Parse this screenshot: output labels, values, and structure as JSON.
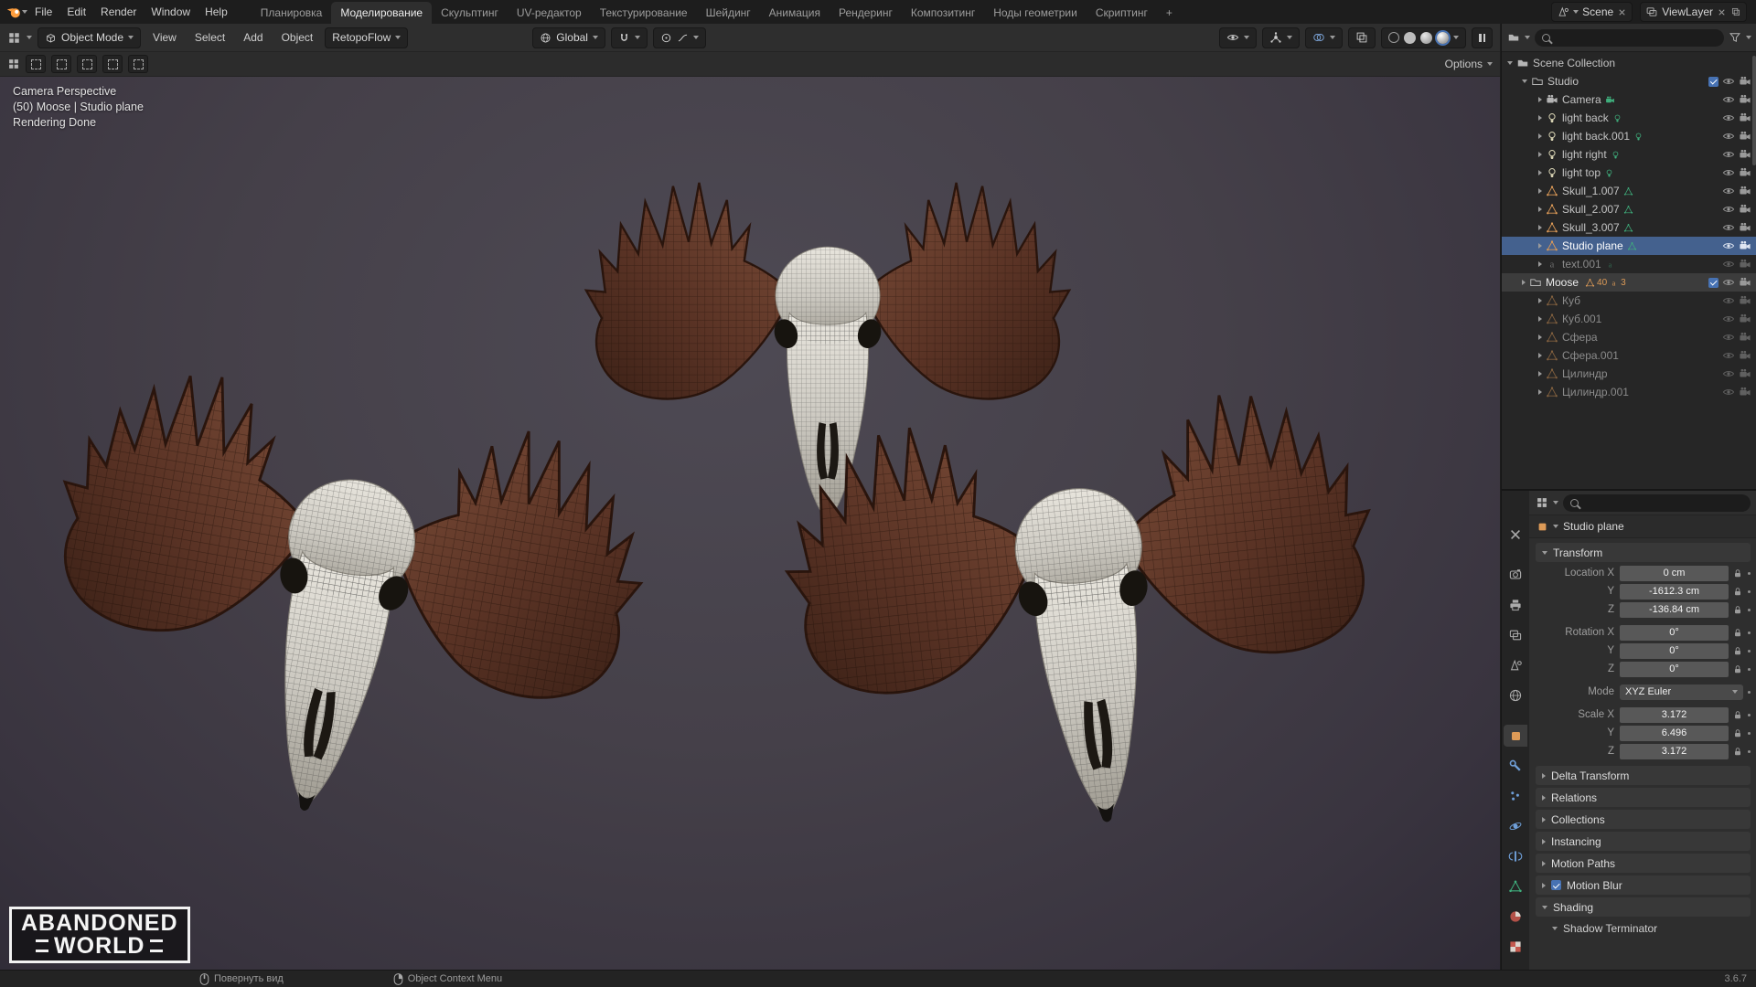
{
  "topbar": {
    "menus": [
      "File",
      "Edit",
      "Render",
      "Window",
      "Help"
    ],
    "workspaces": [
      "Планировка",
      "Моделирование",
      "Скульптинг",
      "UV-редактор",
      "Текстурирование",
      "Шейдинг",
      "Анимация",
      "Рендеринг",
      "Композитинг",
      "Ноды геометрии",
      "Скриптинг"
    ],
    "active_workspace": "Моделирование",
    "add_workspace_label": "+",
    "scene": {
      "label": "Scene"
    },
    "view_layer": {
      "label": "ViewLayer"
    }
  },
  "viewport_header": {
    "mode_selector": "Object Mode",
    "menus": [
      "View",
      "Select",
      "Add",
      "Object"
    ],
    "retopoflow_label": "RetopoFlow",
    "orientation": "Global"
  },
  "tool_settings": {
    "options_label": "Options"
  },
  "viewport": {
    "overlay_text": [
      "Camera Perspective",
      "(50) Moose | Studio plane",
      "Rendering Done"
    ],
    "watermark": {
      "line1": "ABANDONED",
      "line2": "WORLD"
    }
  },
  "outliner": {
    "search_value": "",
    "rows": [
      {
        "label": "Scene Collection",
        "icon": "scene-collection"
      },
      {
        "label": "Studio",
        "icon": "collection",
        "checkbox": true
      },
      {
        "label": "Camera",
        "icon": "camera"
      },
      {
        "label": "light back",
        "icon": "light"
      },
      {
        "label": "light back.001",
        "icon": "light"
      },
      {
        "label": "light right",
        "icon": "light"
      },
      {
        "label": "light top",
        "icon": "light"
      },
      {
        "label": "Skull_1.007",
        "icon": "mesh"
      },
      {
        "label": "Skull_2.007",
        "icon": "mesh"
      },
      {
        "label": "Skull_3.007",
        "icon": "mesh"
      },
      {
        "label": "Studio plane",
        "icon": "mesh",
        "selected": true
      },
      {
        "label": "text.001",
        "icon": "font",
        "dimmed": true
      },
      {
        "label": "Moose",
        "icon": "collection",
        "checkbox": true,
        "badges": {
          "mesh_count": "40",
          "font_count": "3"
        }
      },
      {
        "label": "Куб",
        "icon": "mesh",
        "dimmed": true
      },
      {
        "label": "Куб.001",
        "icon": "mesh",
        "dimmed": true
      },
      {
        "label": "Сфера",
        "icon": "mesh",
        "dimmed": true
      },
      {
        "label": "Сфера.001",
        "icon": "mesh",
        "dimmed": true
      },
      {
        "label": "Цилиндр",
        "icon": "mesh",
        "dimmed": true
      },
      {
        "label": "Цилиндр.001",
        "icon": "mesh",
        "dimmed": true
      }
    ]
  },
  "properties": {
    "search_value": "",
    "breadcrumb": "Studio plane",
    "transform": {
      "title": "Transform",
      "rows": [
        {
          "label": "Location X",
          "value": "0 cm"
        },
        {
          "label": "Y",
          "value": "-1612.3 cm"
        },
        {
          "label": "Z",
          "value": "-136.84 cm"
        },
        {
          "label": "Rotation X",
          "value": "0°"
        },
        {
          "label": "Y",
          "value": "0°"
        },
        {
          "label": "Z",
          "value": "0°"
        },
        {
          "label": "Mode",
          "value": "XYZ Euler"
        },
        {
          "label": "Scale X",
          "value": "3.172"
        },
        {
          "label": "Y",
          "value": "6.496"
        },
        {
          "label": "Z",
          "value": "3.172"
        }
      ]
    },
    "sections": [
      {
        "label": "Delta Transform"
      },
      {
        "label": "Relations"
      },
      {
        "label": "Collections"
      },
      {
        "label": "Instancing"
      },
      {
        "label": "Motion Paths"
      },
      {
        "label": "Motion Blur",
        "checkbox": true,
        "checked": true
      },
      {
        "label": "Shading",
        "expanded": true
      }
    ],
    "shading_subsection": "Shadow Terminator"
  },
  "statusbar": {
    "hints": [
      {
        "label": "Повернуть вид"
      },
      {
        "label": "Object Context Menu"
      }
    ],
    "version": "3.6.7"
  },
  "colors": {
    "accent": "#4772b3",
    "object_orange": "#dd9a57",
    "data_green": "#3fae7c",
    "selection_row": "#44618e"
  }
}
